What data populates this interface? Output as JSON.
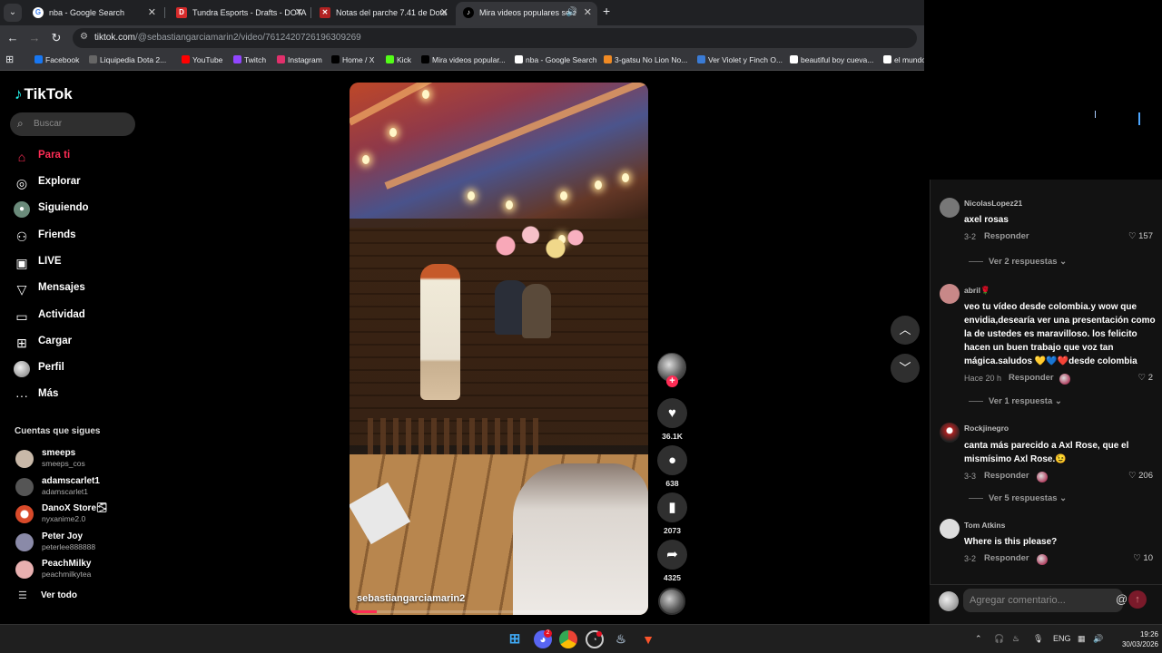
{
  "browser": {
    "tabs": [
      {
        "title": "nba - Google Search",
        "icon": "google-icon",
        "color": "#ffffff"
      },
      {
        "title": "Tundra Esports - Drafts - DOTA",
        "icon": "dotabuff-icon",
        "color": "#d62b2b"
      },
      {
        "title": "Notas del parche 7.41 de Dota",
        "icon": "dota-icon",
        "color": "#b22222"
      },
      {
        "title": "Mira videos populares sele",
        "icon": "tiktok-icon",
        "color": "#000000"
      }
    ],
    "url_host": "tiktok.com",
    "url_path": "/@sebastiangarciamarin2/video/7612420726196309269",
    "bookmarks": [
      {
        "label": "Facebook",
        "icon": "facebook-icon",
        "color": "#1877f2"
      },
      {
        "label": "Liquipedia Dota 2...",
        "icon": "liquipedia-icon",
        "color": "#666666"
      },
      {
        "label": "YouTube",
        "icon": "youtube-icon",
        "color": "#ff0000"
      },
      {
        "label": "Twitch",
        "icon": "twitch-icon",
        "color": "#9146ff"
      },
      {
        "label": "Instagram",
        "icon": "instagram-icon",
        "color": "#e1306c"
      },
      {
        "label": "Home / X",
        "icon": "x-icon",
        "color": "#000000"
      },
      {
        "label": "Kick",
        "icon": "kick-icon",
        "color": "#53fc18"
      },
      {
        "label": "Mira videos popular...",
        "icon": "tiktok-icon",
        "color": "#000000"
      },
      {
        "label": "nba - Google Search",
        "icon": "google-icon",
        "color": "#ffffff"
      },
      {
        "label": "3-gatsu No Lion No...",
        "icon": "bookmark-orange-icon",
        "color": "#f08a24"
      },
      {
        "label": "Ver Violet y Finch O...",
        "icon": "site-icon",
        "color": "#3a7bd5"
      },
      {
        "label": "beautiful boy cueva...",
        "icon": "google-icon",
        "color": "#ffffff"
      },
      {
        "label": "el mundo",
        "icon": "google-icon",
        "color": "#ffffff"
      }
    ]
  },
  "tiktok": {
    "logo": "TikTok",
    "search_placeholder": "Buscar",
    "nav": [
      {
        "label": "Para ti",
        "icon": "home-icon"
      },
      {
        "label": "Explorar",
        "icon": "compass-icon"
      },
      {
        "label": "Siguiendo",
        "icon": "following-icon"
      },
      {
        "label": "Friends",
        "icon": "friends-icon"
      },
      {
        "label": "LIVE",
        "icon": "live-icon"
      },
      {
        "label": "Mensajes",
        "icon": "send-icon"
      },
      {
        "label": "Actividad",
        "icon": "activity-icon"
      },
      {
        "label": "Cargar",
        "icon": "upload-icon"
      },
      {
        "label": "Perfil",
        "icon": "profile-icon"
      },
      {
        "label": "Más",
        "icon": "more-icon"
      }
    ],
    "following_title": "Cuentas que sigues",
    "following": [
      {
        "name": "smeeps",
        "user": "smeeps_cos",
        "color": "#c8b8a8"
      },
      {
        "name": "adamscarlet1",
        "user": "adamscarlet1",
        "color": "#555555"
      },
      {
        "name": "DanoX Store🌫",
        "user": "nyxanime2.0",
        "color": "#d84a2a"
      },
      {
        "name": "Peter Joy",
        "user": "peterlee888888",
        "color": "#8a8aa8"
      },
      {
        "name": "PeachMilky",
        "user": "peachmilkytea",
        "color": "#e8b0b0"
      }
    ],
    "see_all": "Ver todo",
    "video": {
      "author": "sebastiangarciamarin2",
      "progress": 0.09
    },
    "actions": {
      "likes": "36.1K",
      "comments": "638",
      "saves": "2073",
      "shares": "4325"
    }
  },
  "comments": {
    "items": [
      {
        "user": "NicolasLopez21",
        "text": "axel rosas",
        "date": "3-2",
        "reply": "Responder",
        "likes": "157",
        "more": "Ver 2 respuestas",
        "color": "#777777"
      },
      {
        "user": "abril🌹",
        "text": "veo tu vídeo desde colombia.y wow que envidia,desearía ver una presentación como la de ustedes es maravilloso. los felicito hacen un buen trabajo que voz tan mágica.saludos 💛💙❤️desde colombia",
        "date": "Hace 20 h",
        "reply": "Responder",
        "likes": "2",
        "more": "Ver 1 respuesta",
        "color": "#c88888"
      },
      {
        "user": "Rockjinegro",
        "text": "canta más parecido a Axl Rose, que el mismísimo Axl Rose.😉",
        "date": "3-3",
        "reply": "Responder",
        "likes": "206",
        "more": "Ver 5 respuestas",
        "color": "#aa2222"
      },
      {
        "user": "Tom Atkins",
        "text": "Where is this please?",
        "date": "3-2",
        "reply": "Responder",
        "likes": "10",
        "more": "",
        "color": "#dddddd"
      }
    ],
    "input_placeholder": "Agregar comentario..."
  },
  "taskbar": {
    "lang": "ENG",
    "time": "19:26",
    "date": "30/03/2026",
    "discord_badge": "2"
  }
}
